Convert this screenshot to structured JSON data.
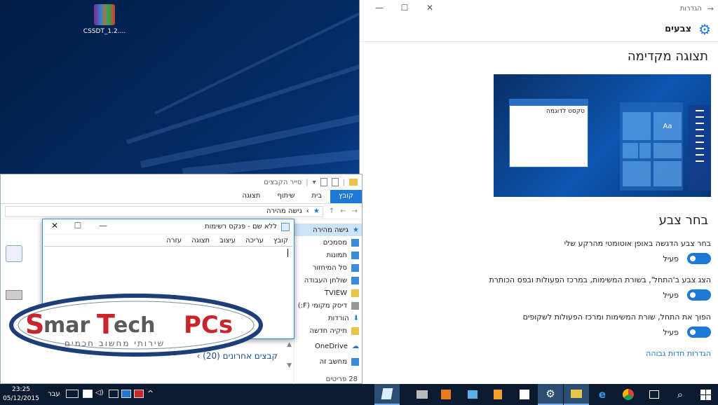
{
  "desktop": {
    "icon_label": "CSSDT_1.2...."
  },
  "settings": {
    "window_title": "הגדרות",
    "header": "צבעים",
    "preview_title": "תצוגה מקדימה",
    "preview_sample_text": "טקסט לדוגמה",
    "preview_tile_label": "Aa",
    "choose_color_title": "בחר צבע",
    "options": [
      {
        "label": "בחר צבע הדגשה באופן אוטומטי מהרקע שלי",
        "state": "פעיל"
      },
      {
        "label": "הצג צבע ב'התחל', בשורת המשימות, במרכז הפעולות ובפס הכותרת",
        "state": "פעיל"
      },
      {
        "label": "הפוך את התחל, שורת המשימות ומרכז הפעולות לשקופים",
        "state": "פעיל"
      }
    ],
    "link": "הגדרות חדות גבוהה",
    "accent": "#1e78d6"
  },
  "explorer": {
    "title": "סייר הקבצים",
    "ribbon_tabs": [
      "קובץ",
      "בית",
      "שיתוף",
      "תצוגה"
    ],
    "address": "גישה מהירה",
    "nav_items": [
      "גישה מהירה",
      "מסמכים",
      "תמונות",
      "סל המיחזור",
      "שולחן העבודה",
      "TVIEW",
      "דיסק מקומי (F:)",
      "הורדות",
      "תיקיה חדשה",
      "OneDrive",
      "מחשב זה"
    ],
    "recent_files": "קבצים אחרונים (20)",
    "status": "28 פריטים"
  },
  "notepad": {
    "title": "ללא שם - פנקס רשימות",
    "menu": [
      "קובץ",
      "עריכה",
      "עיצוב",
      "תצוגה",
      "עזרה"
    ]
  },
  "logo": {
    "brand": "SmarTech PCs",
    "tagline": "שירותי מחשוב חכמים"
  },
  "taskbar": {
    "time": "23:25",
    "date": "05/12/2015",
    "language": "עבר"
  }
}
